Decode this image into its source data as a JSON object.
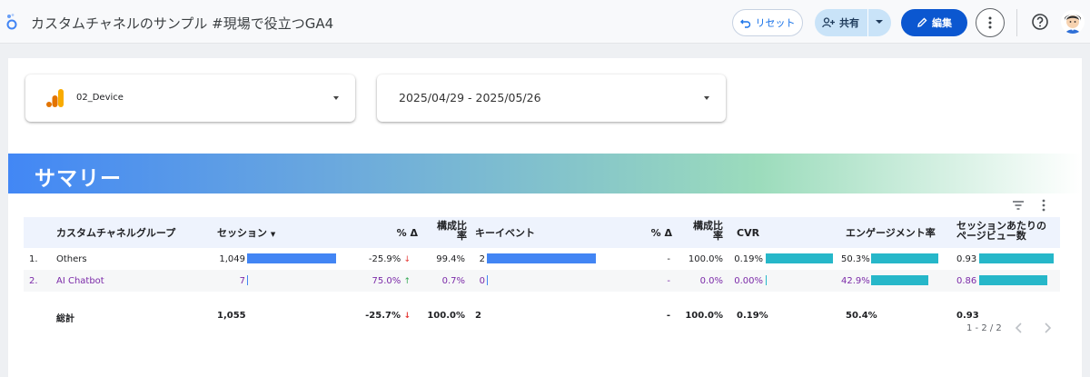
{
  "header": {
    "title": "カスタムチャネルのサンプル #現場で役立つGA4",
    "reset_label": "リセット",
    "share_label": "共有",
    "edit_label": "編集"
  },
  "controls": {
    "device_value": "02_Device",
    "date_range": "2025/04/29 - 2025/05/26"
  },
  "section": {
    "title": "サマリー"
  },
  "table": {
    "headers": {
      "channel_group": "カスタムチャネルグループ",
      "sessions": "セッション",
      "pct_delta_1": "% Δ",
      "share_1_a": "構成比",
      "share_1_b": "率",
      "key_events": "キーイベント",
      "pct_delta_2": "% Δ",
      "share_2_a": "構成比",
      "share_2_b": "率",
      "cvr": "CVR",
      "engagement_rate": "エンゲージメント率",
      "pv_per_session_a": "セッションあたりの",
      "pv_per_session_b": "ページビュー数"
    },
    "rows": [
      {
        "index": "1.",
        "channel": "Others",
        "sessions": "1,049",
        "sessions_frac": 1.0,
        "delta1": "-25.9%",
        "share1": "99.4%",
        "key_events": "2",
        "key_events_frac": 1.0,
        "delta2": "-",
        "share2": "100.0%",
        "cvr": "0.19%",
        "cvr_frac": 1.0,
        "engagement": "50.3%",
        "engagement_frac": 1.0,
        "pv": "0.93",
        "pv_frac": 1.0
      },
      {
        "index": "2.",
        "channel": "AI Chatbot",
        "sessions": "7",
        "sessions_frac": 0.007,
        "delta1": "75.0%",
        "share1": "0.7%",
        "key_events": "0",
        "key_events_frac": 0.0,
        "delta2": "-",
        "share2": "0.0%",
        "cvr": "0.00%",
        "cvr_frac": 0.0,
        "engagement": "42.9%",
        "engagement_frac": 0.85,
        "pv": "0.86",
        "pv_frac": 0.92
      }
    ],
    "total": {
      "label": "総計",
      "sessions": "1,055",
      "delta1": "-25.7%",
      "share1": "100.0%",
      "key_events": "2",
      "delta2": "-",
      "share2": "100.0%",
      "cvr": "0.19%",
      "engagement": "50.4%",
      "pv": "0.93"
    },
    "pagination": "1 - 2 / 2"
  },
  "colors": {
    "bar_blue": "#4285f4",
    "bar_teal": "#26b7c9",
    "primary": "#0b57d0"
  }
}
